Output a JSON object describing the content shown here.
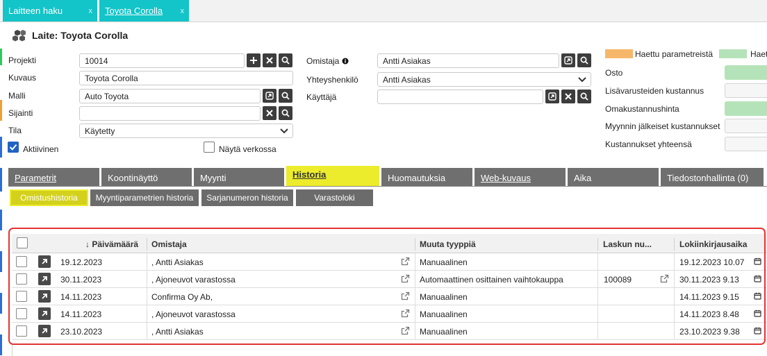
{
  "tabs": [
    {
      "label": "Laitteen haku",
      "close": "x"
    },
    {
      "label": "Toyota Corolla",
      "close": "x"
    }
  ],
  "header": {
    "title": "Laite: Toyota Corolla",
    "icon": "cubes-icon"
  },
  "form": {
    "projekti_label": "Projekti",
    "projekti_value": "10014",
    "kuvaus_label": "Kuvaus",
    "kuvaus_value": "Toyota Corolla",
    "malli_label": "Malli",
    "malli_value": "Auto Toyota",
    "sijainti_label": "Sijainti",
    "sijainti_value": "",
    "tila_label": "Tila",
    "tila_value": "Käytetty",
    "aktiivinen_label": "Aktiivinen",
    "aktiivinen_checked": true,
    "omistaja_label": "Omistaja",
    "omistaja_value": "Antti Asiakas",
    "yhteyshenkilo_label": "Yhteyshenkilö",
    "yhteyshenkilo_value": "Antti Asiakas",
    "kayttaja_label": "Käyttäjä",
    "kayttaja_value": "",
    "nayta_label": "Näytä verkossa",
    "nayta_checked": false
  },
  "costs": {
    "legend_orange": "Haettu parametreistä",
    "legend_green": "Haettu",
    "orange_color": "#f6b76b",
    "green_color": "#b5e3b9",
    "items": [
      "Osto",
      "Lisävarusteiden kustannus",
      "Omakustannushinta",
      "Myynnin jälkeiset kustannukset",
      "Kustannukset yhteensä"
    ]
  },
  "section_tabs": [
    "Parametrit",
    "Koontinäyttö",
    "Myynti",
    "Historia",
    "Huomautuksia",
    "Web-kuvaus",
    "Aika",
    "Tiedostonhallinta (0)"
  ],
  "active_section_tab": "Historia",
  "sub_tabs": [
    "Omistushistoria",
    "Myyntiparametrien historia",
    "Sarjanumeron historia",
    "Varastoloki"
  ],
  "active_sub_tab": "Omistushistoria",
  "grid": {
    "sort_arrow": "↓",
    "columns": [
      "Päivämäärä",
      "Omistaja",
      "Muuta tyyppiä",
      "Laskun nu...",
      "Lokiinkirjausaika"
    ],
    "rows": [
      {
        "date": "19.12.2023",
        "owner": ", Antti Asiakas",
        "type": "Manuaalinen",
        "invoice": "",
        "logged": "19.12.2023 10.07"
      },
      {
        "date": "30.11.2023",
        "owner": ", Ajoneuvot varastossa",
        "type": "Automaattinen osittainen vaihtokauppa",
        "invoice": "100089",
        "logged": "30.11.2023 9.13"
      },
      {
        "date": "14.11.2023",
        "owner": "Confirma Oy Ab,",
        "type": "Manuaalinen",
        "invoice": "",
        "logged": "14.11.2023 9.15"
      },
      {
        "date": "14.11.2023",
        "owner": ", Ajoneuvot varastossa",
        "type": "Manuaalinen",
        "invoice": "",
        "logged": "14.11.2023 8.48"
      },
      {
        "date": "23.10.2023",
        "owner": ", Antti Asiakas",
        "type": "Manuaalinen",
        "invoice": "",
        "logged": "23.10.2023 9.38"
      }
    ]
  }
}
